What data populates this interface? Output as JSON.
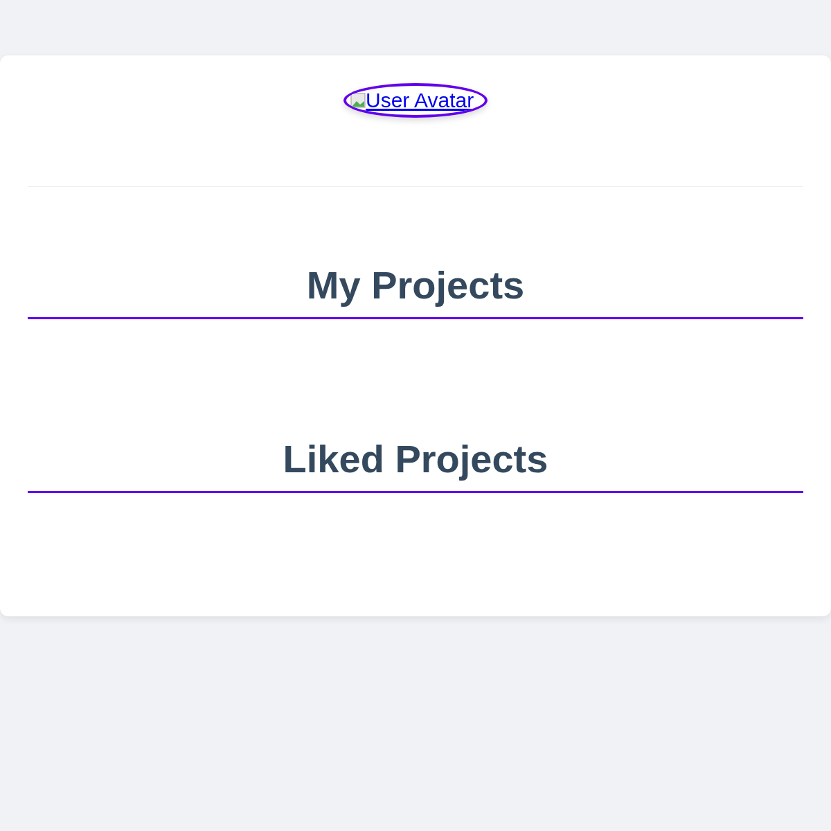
{
  "avatar": {
    "alt_text": "User Avatar"
  },
  "sections": [
    {
      "title": "My Projects"
    },
    {
      "title": "Liked Projects"
    }
  ]
}
